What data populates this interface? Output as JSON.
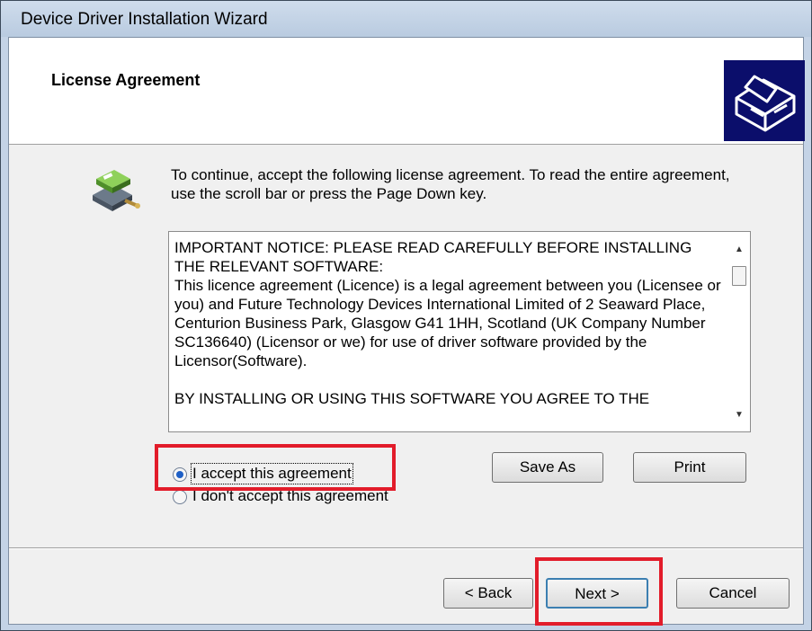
{
  "window": {
    "title": "Device Driver Installation Wizard"
  },
  "header": {
    "title": "License Agreement",
    "logo_icon": "computer-drive-logo-icon"
  },
  "intro": {
    "icon": "installation-package-icon",
    "text": "To continue, accept the following license agreement. To read the entire agreement, use the scroll bar or press the Page Down key."
  },
  "license": {
    "text": "IMPORTANT NOTICE: PLEASE READ CAREFULLY BEFORE INSTALLING THE RELEVANT SOFTWARE:\nThis licence agreement (Licence) is a legal agreement between you (Licensee or you) and Future Technology Devices International Limited of 2 Seaward Place, Centurion Business Park, Glasgow G41 1HH, Scotland (UK Company Number SC136640) (Licensor or we) for use of driver software provided by the Licensor(Software).\n\nBY INSTALLING OR USING THIS SOFTWARE YOU AGREE TO THE"
  },
  "options": {
    "accept_label": "I accept this agreement",
    "decline_label": "I don't accept this agreement",
    "selected": "accept"
  },
  "buttons": {
    "save_as": "Save As",
    "print": "Print",
    "back": "< Back",
    "next": "Next >",
    "cancel": "Cancel"
  },
  "annotations": {
    "highlight_color": "#e21c2a"
  }
}
